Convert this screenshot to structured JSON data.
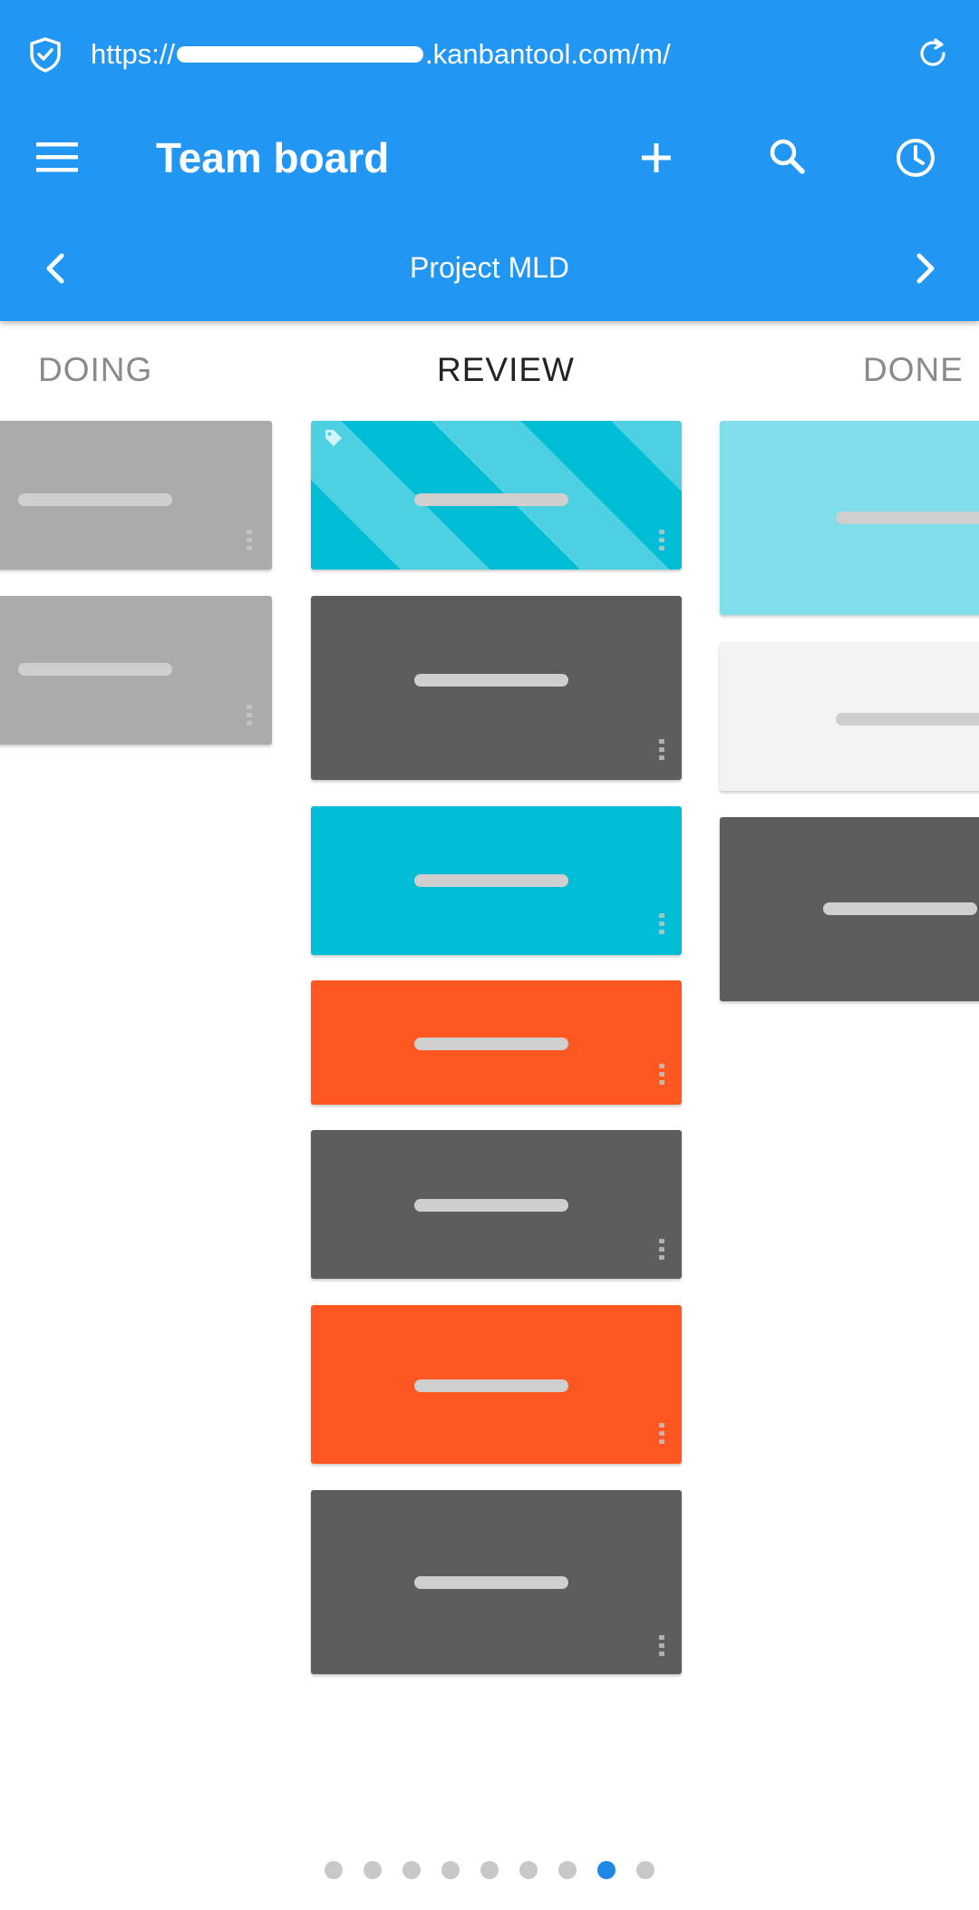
{
  "browser": {
    "url_prefix": "https://",
    "url_suffix": ".kanbantool.com/m/"
  },
  "appbar": {
    "title": "Team board"
  },
  "project": {
    "name": "Project MLD"
  },
  "columns": [
    {
      "title": "DOING"
    },
    {
      "title": "REVIEW"
    },
    {
      "title": "DONE"
    }
  ],
  "colors": {
    "primary": "#2196f3",
    "card_gray_light": "#ababab",
    "card_gray_dark": "#5d5d5d",
    "card_cyan": "#00bcd4",
    "card_cyan_light": "#80deea",
    "card_orange": "#ff5722",
    "card_white": "#f3f3f3",
    "pager_active": "#1e88e5"
  },
  "pager": {
    "total": 9,
    "active_index": 7
  }
}
